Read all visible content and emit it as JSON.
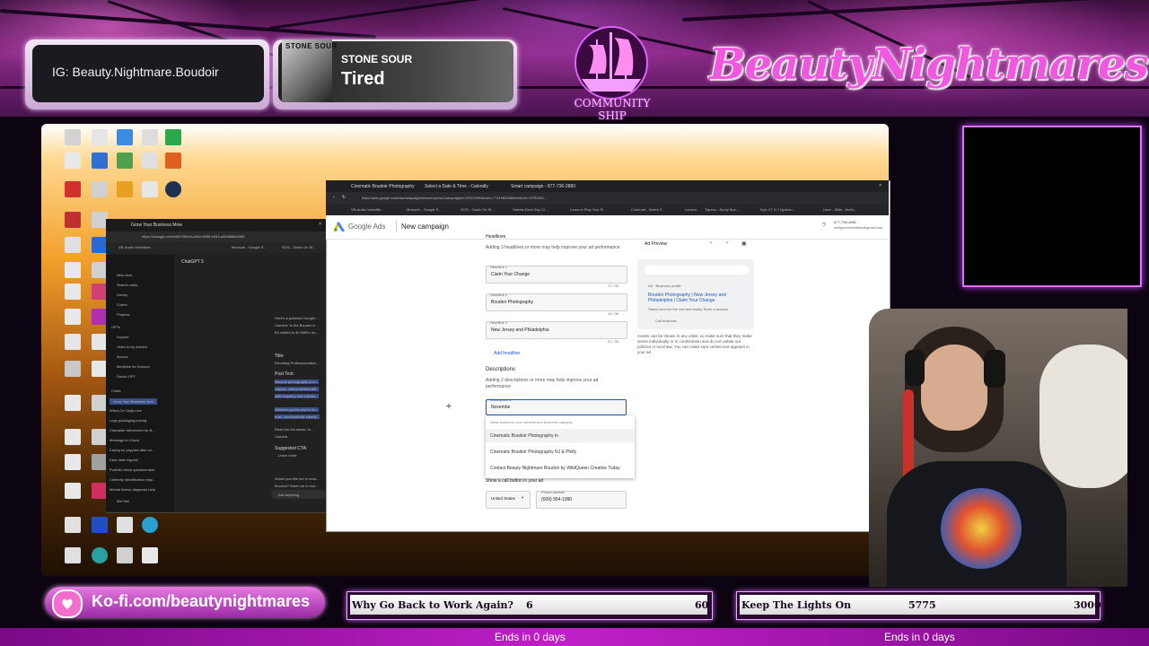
{
  "overlay": {
    "instagram": "IG: Beauty.Nightmare.Boudoir",
    "now_playing": {
      "album_label": "STONE SOUR",
      "artist": "STONE SOUR",
      "track": "Tired"
    },
    "badge": "COMMUNITY SHIP",
    "channel_logo": "BeautyNightmares",
    "kofi": "Ko-fi.com/beautynightmares",
    "goals": [
      {
        "title": "Why Go Back to Work Again?",
        "current": "6",
        "target": "60",
        "fill": 1.0,
        "ends": "Ends in 0 days"
      },
      {
        "title": "Keep The Lights On",
        "current": "5775",
        "target": "3000",
        "fill": 1.0,
        "ends": "Ends in 0 days"
      }
    ]
  },
  "chat_window": {
    "tab_title": "Grow Your Business Mow",
    "url": "https://chatgpt.com/c/68700b4d-a9be-8065-b253-a52d888be366",
    "bookmarks": [
      "VB-Audio VoiceMee...",
      "Monocle - Google S...",
      "GOS - Garlic On St..."
    ],
    "model": "ChatGPT 5",
    "sidebar": [
      "New chat",
      "Search chats",
      "Library",
      "Codex",
      "Projects",
      "GPTs",
      "Explore",
      "Video AI by invideo",
      "Accord",
      "Medicine for Doctors",
      "Doctor GPT",
      "Chats",
      "Grow Your Business Now",
      "Witch-On Ouija Line",
      "Logo packaging pricing",
      "Character refinement for B...",
      "Message to Chuck",
      "Caring for puppies after wi...",
      "Deal draft request",
      "Portfolio block questionnaire",
      "Celebrity identification requ...",
      "Mental illness diagnosis help",
      "Mel Mel"
    ],
    "content": {
      "intro": "Here's a polished Google...",
      "intro2": "Camera\" in the Boudoir b...",
      "intro3": "It's written to fit GMB's for...",
      "title_label": "Title:",
      "title_value": "Elevating Professionalism...",
      "post_label": "Post Text:",
      "post_lines": [
        "Boudoir photography is m...",
        "respect, and professionali...",
        "with empathy and intentio..."
      ],
      "post_lines2": [
        "Whether you're new to bo...",
        "trust, communicate clearly..."
      ],
      "read_more": "Read the full article: In...",
      "camera": "Camera",
      "cta_label": "Suggested CTA:",
      "cta_value": "Learn more",
      "follow_up": "Would you like me to crea...",
      "follow_up2": "Boudoir? Want me to mor...",
      "ask": "Ask anything"
    }
  },
  "browser": {
    "tabs": [
      "Cinematic Boudoir Photography",
      "Select a Date & Time - Calendly",
      "Smart campaign - 877-736-2880"
    ],
    "url": "https://ads.google.com/aw/campaigns/new/express?campaignId=22322299&ocid=7741965268&emiInfo=%7B%22...",
    "bookmarks": [
      "VB-Audio VoiceMe...",
      "Monocle - Google S...",
      "GOS - Garlic On St...",
      "Streets Deck Key Cl...",
      "Learn to Play Your Fi...",
      "Cmdr.net - Watch F...",
      "Lenovo",
      "Tigress - Booty Box...",
      "Epic XT 3.0 Hydrotu...",
      "Liner - Slide, Verifu..."
    ],
    "app": "Google Ads",
    "page_title": "New campaign",
    "account": "877-736-2880",
    "account_email": "wildqueencreative@gmail.com",
    "headlines": {
      "section": "Headlines",
      "help": "Adding 3 headlines or more may help improve your ad performance",
      "items": [
        {
          "label": "Headline 1",
          "value": "Claim Your Change",
          "count": "17 / 30"
        },
        {
          "label": "Headline 2",
          "value": "Boudoir Photography",
          "count": "19 / 30"
        },
        {
          "label": "Headline 3",
          "value": "New Jersey and Philadelphia",
          "count": "27 / 30"
        }
      ],
      "add": "Add headline"
    },
    "descriptions": {
      "section": "Descriptions",
      "help": "Adding 2 descriptions or more may help improve your ad performance",
      "label": "Description 1",
      "value": "Novembe",
      "suggest_header": "Ideas based on your website and business category",
      "suggestions": [
        "Cinematic Boudoir Photography in",
        "Cinematic Boudoir Photography NJ & Philly",
        "Contact Beauty Nightmare Boudoir by WildQueen Creative Today"
      ]
    },
    "call": {
      "label": "Show a call button in your ad",
      "country": "United States",
      "phone_label": "Phone number",
      "phone": "(609) 954-1990"
    },
    "preview": {
      "title": "Ad Preview",
      "ad_tag": "Ad · Business profile",
      "headline": "Boudoir Photography | New Jersey and Philadelphia | Claim Your Change",
      "desc": "Stand out from the rest and boldly. Book a session.",
      "call": "Call business",
      "note": "Assets can be shown in any order, so make sure that they make sense individually or in combination and do not violate our policies or local law. You can make sure certain text appears in your ad"
    }
  },
  "colors": {
    "accent": "#e040ff",
    "kofi": "#d960d4",
    "ga_blue": "#1a73e8"
  }
}
